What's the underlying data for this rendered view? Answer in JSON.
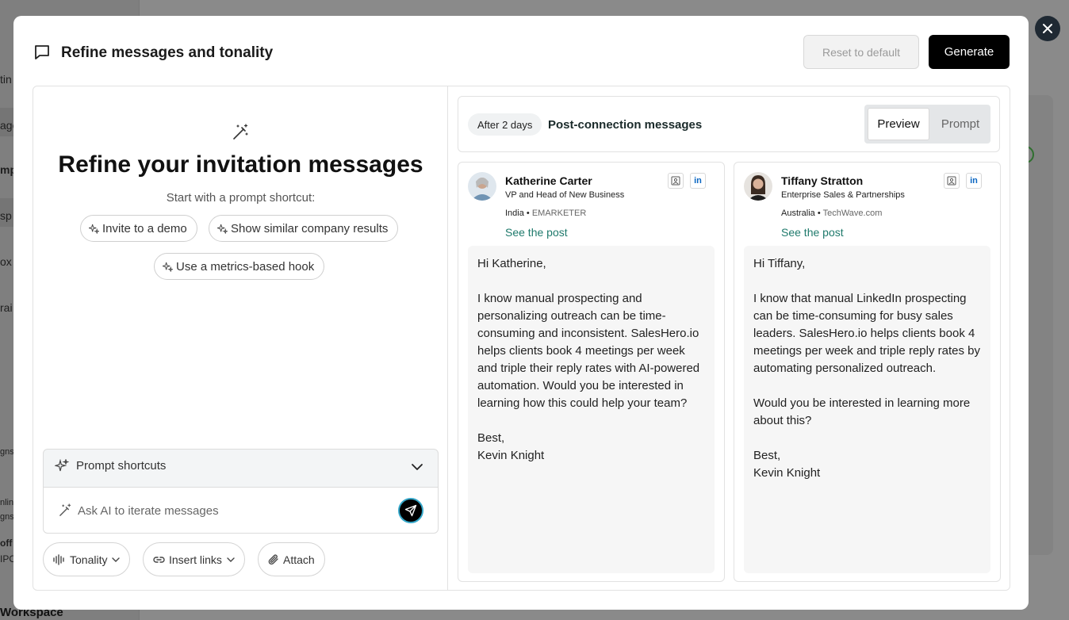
{
  "background": {
    "sidebar_fragments": [
      "tin",
      "age",
      "mp",
      "sp",
      "ox",
      "rai",
      "gns",
      "nlin",
      "gns",
      "off",
      "IPC"
    ],
    "workspace_label": "Workspace"
  },
  "modal": {
    "title": "Refine messages and tonality",
    "reset_label": "Reset to default",
    "generate_label": "Generate",
    "close_icon": "close-icon"
  },
  "left": {
    "hero_title": "Refine your invitation messages",
    "hero_subtitle": "Start with a prompt shortcut:",
    "chips": [
      "Invite to a demo",
      "Show similar company results",
      "Use a metrics-based hook"
    ],
    "shortcuts_label": "Prompt shortcuts",
    "ask_placeholder": "Ask AI to iterate messages",
    "tools": {
      "tonality": "Tonality",
      "insert_links": "Insert links",
      "attach": "Attach"
    }
  },
  "right": {
    "delay_badge": "After 2 days",
    "step_title": "Post-connection messages",
    "view_toggle": {
      "preview": "Preview",
      "prompt": "Prompt",
      "selected": "Preview"
    },
    "cards": [
      {
        "name": "Katherine Carter",
        "role": "VP and Head of New Business",
        "country": "India",
        "company": "EMARKETER",
        "link": "See the post",
        "message": "Hi Katherine,\n\nI know manual prospecting and personalizing outreach can be time-consuming and inconsistent. SalesHero.io helps clients book 4 meetings per week and triple their reply rates with AI-powered automation. Would you be interested in learning how this could help your team?\n\nBest,\nKevin Knight"
      },
      {
        "name": "Tiffany Stratton",
        "role": "Enterprise Sales & Partnerships",
        "country": "Australia",
        "company": "TechWave.com",
        "link": "See the post",
        "message": "Hi Tiffany,\n\nI know that manual LinkedIn prospecting can be time-consuming for busy sales leaders. SalesHero.io helps clients book 4 meetings per week and triple reply rates by automating personalized outreach.\n\nWould you be interested in learning more about this?\n\nBest,\nKevin Knight"
      }
    ],
    "linkedin_glyph": "in",
    "separator": "•"
  },
  "colors": {
    "primary": "#000000",
    "link": "#1f7a6c",
    "linkedin": "#0a66c2",
    "send_ring": "#35a7c9"
  }
}
